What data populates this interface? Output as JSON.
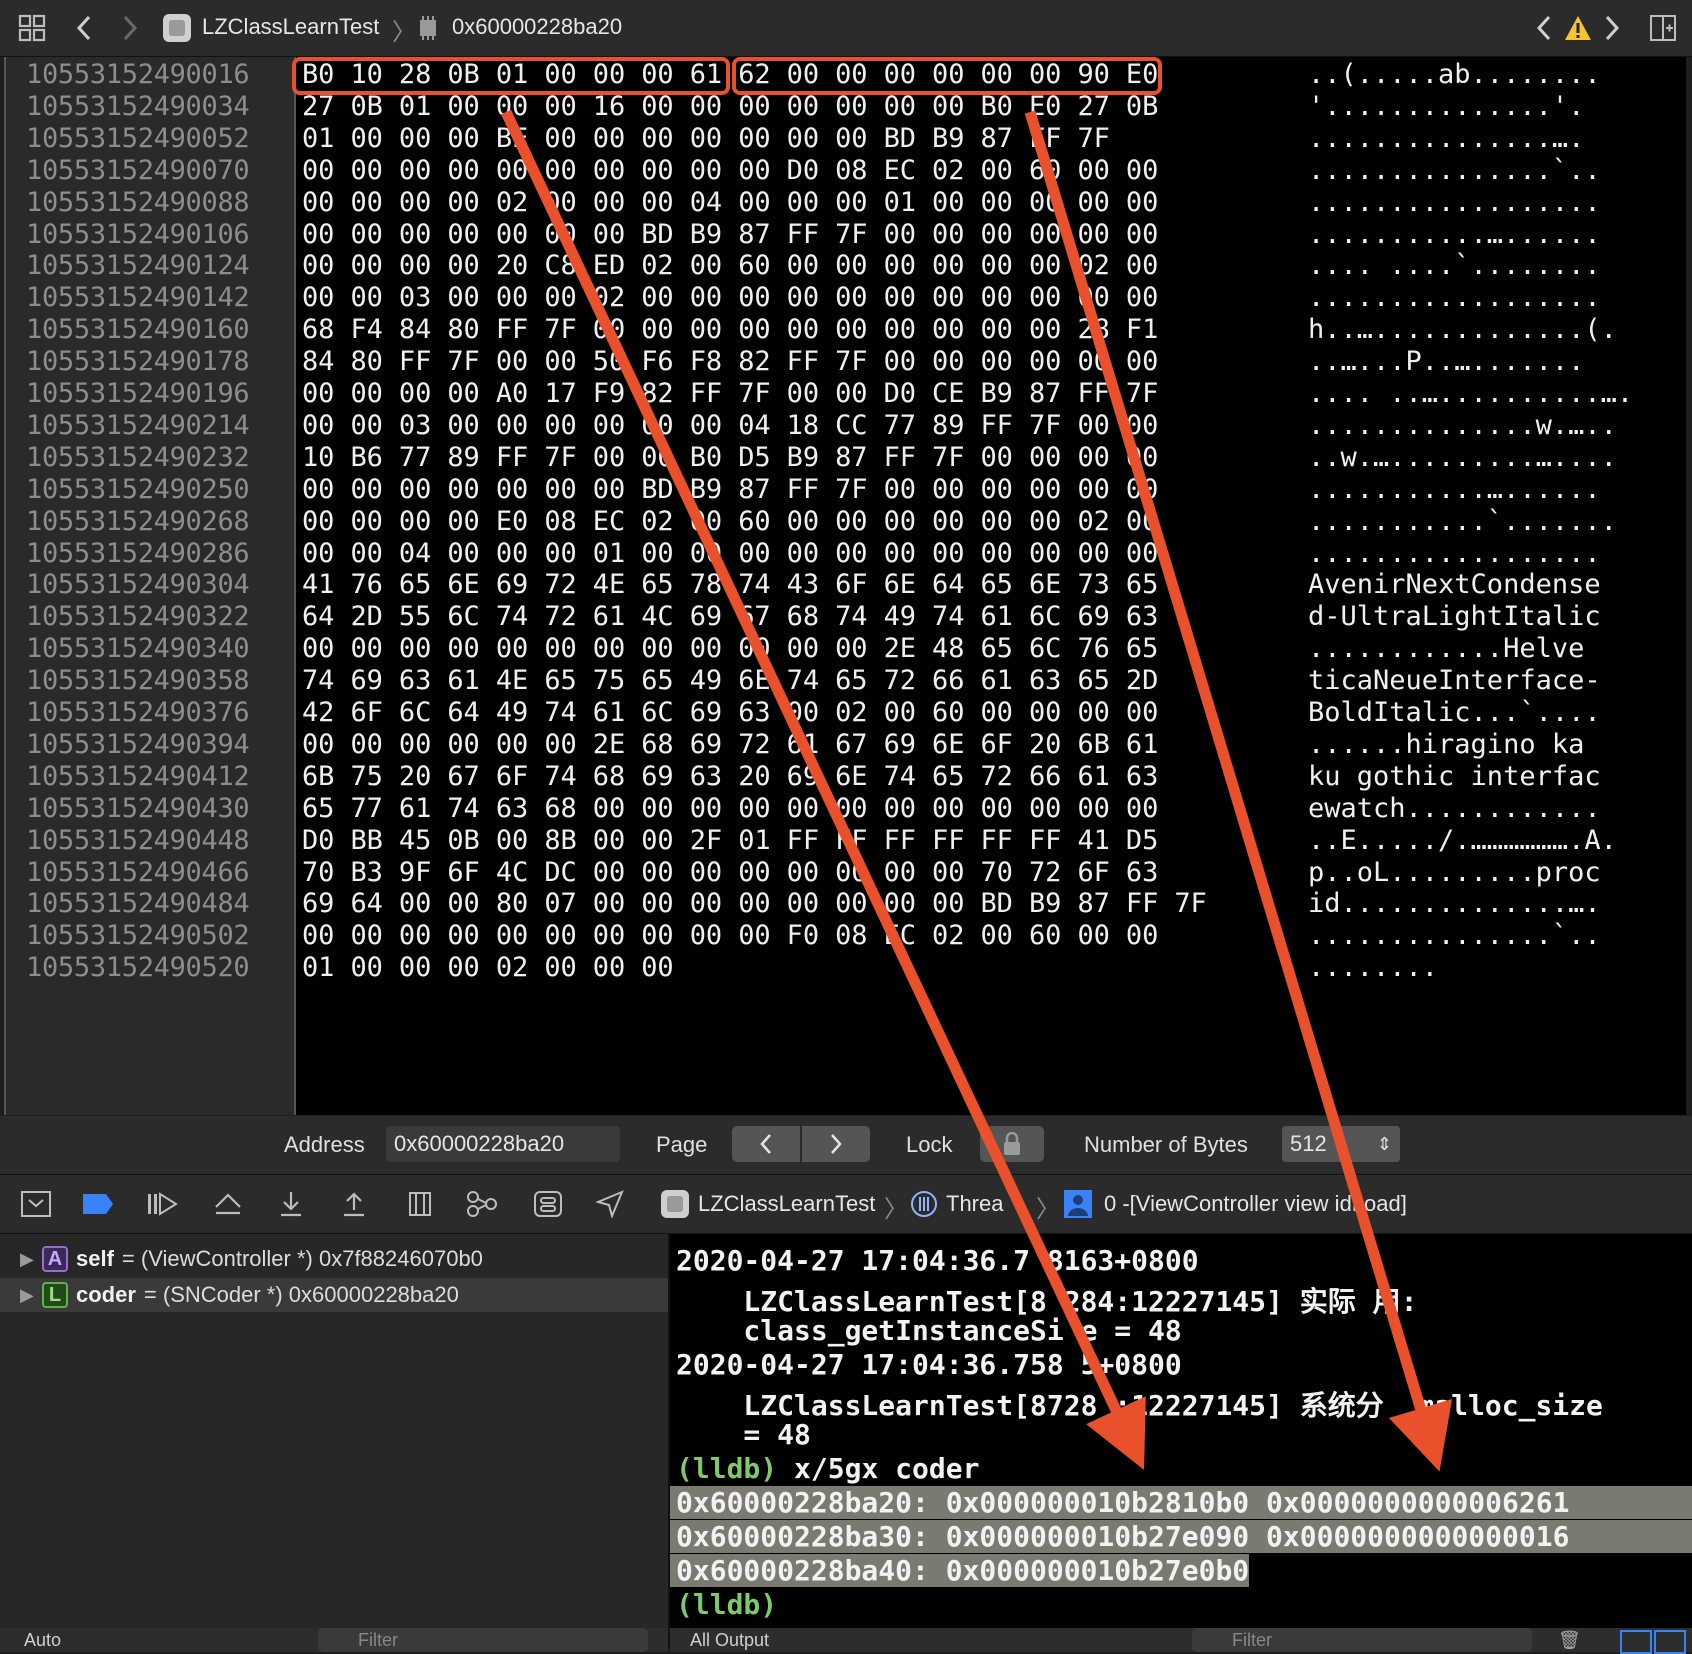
{
  "toolbar": {
    "breadcrumb_project": "LZClassLearnTest",
    "breadcrumb_memory": "0x60000228ba20"
  },
  "memory": {
    "addresses": [
      "10553152490016",
      "10553152490034",
      "10553152490052",
      "10553152490070",
      "10553152490088",
      "10553152490106",
      "10553152490124",
      "10553152490142",
      "10553152490160",
      "10553152490178",
      "10553152490196",
      "10553152490214",
      "10553152490232",
      "10553152490250",
      "10553152490268",
      "10553152490286",
      "10553152490304",
      "10553152490322",
      "10553152490340",
      "10553152490358",
      "10553152490376",
      "10553152490394",
      "10553152490412",
      "10553152490430",
      "10553152490448",
      "10553152490466",
      "10553152490484",
      "10553152490502",
      "10553152490520"
    ],
    "hex": [
      "B0 10 28 0B 01 00 00 00 61 62 00 00 00 00 00 00 90 E0",
      "27 0B 01 00 00 00 16 00 00 00 00 00 00 00 B0 E0 27 0B",
      "01 00 00 00 BE 00 00 00 00 00 00 00 BD B9 87 FF 7F",
      "00 00 00 00 00 00 00 00 00 00 D0 08 EC 02 00 60 00 00",
      "00 00 00 00 02 00 00 00 04 00 00 00 01 00 00 00 00 00",
      "00 00 00 00 00 00 00 BD B9 87 FF 7F 00 00 00 00 00 00",
      "00 00 00 00 20 C8 ED 02 00 60 00 00 00 00 00 00 02 00",
      "00 00 03 00 00 00 02 00 00 00 00 00 00 00 00 00 00 00",
      "68 F4 84 80 FF 7F 00 00 00 00 00 00 00 00 00 00 28 F1",
      "84 80 FF 7F 00 00 50 F6 F8 82 FF 7F 00 00 00 00 00 00",
      "00 00 00 00 A0 17 F9 82 FF 7F 00 00 D0 CE B9 87 FF 7F",
      "00 00 03 00 00 00 00 00 00 04 18 CC 77 89 FF 7F 00 00",
      "10 B6 77 89 FF 7F 00 00 B0 D5 B9 87 FF 7F 00 00 00 00",
      "00 00 00 00 00 00 00 BD B9 87 FF 7F 00 00 00 00 00 00",
      "00 00 00 00 E0 08 EC 02 00 60 00 00 00 00 00 00 02 00",
      "00 00 04 00 00 00 01 00 00 00 00 00 00 00 00 00 00 00",
      "41 76 65 6E 69 72 4E 65 78 74 43 6F 6E 64 65 6E 73 65",
      "64 2D 55 6C 74 72 61 4C 69 67 68 74 49 74 61 6C 69 63",
      "00 00 00 00 00 00 00 00 00 00 00 00 2E 48 65 6C 76 65",
      "74 69 63 61 4E 65 75 65 49 6E 74 65 72 66 61 63 65 2D",
      "42 6F 6C 64 49 74 61 6C 69 63 00 02 00 60 00 00 00 00",
      "00 00 00 00 00 00 2E 68 69 72 61 67 69 6E 6F 20 6B 61",
      "6B 75 20 67 6F 74 68 69 63 20 69 6E 74 65 72 66 61 63",
      "65 77 61 74 63 68 00 00 00 00 00 00 00 00 00 00 00 00",
      "D0 BB 45 0B 00 8B 00 00 2F 01 FF FF FF FF FF FF 41 D5",
      "70 B3 9F 6F 4C DC 00 00 00 00 00 00 00 00 70 72 6F 63",
      "69 64 00 00 80 07 00 00 00 00 00 00 00 00 BD B9 87 FF 7F",
      "00 00 00 00 00 00 00 00 00 00 F0 08 EC 02 00 60 00 00",
      "01 00 00 00 02 00 00 00"
    ],
    "ascii": [
      "..(.....ab........",
      "'..............'.",
      "...............….",
      "...............`..",
      "..................",
      "...........…......",
      ".... ....`........",
      "..................",
      "h..….............(.",
      "..…...P..….......",
      ".... ..…..........….",
      "..............w.…..",
      "..w.….........…....",
      "...........…......",
      "...........`.......",
      "..................",
      "AvenirNextCondense",
      "d-UltraLightItalic",
      "............Helve",
      "ticaNeueInterface-",
      "BoldItalic...`....",
      "......hiragino ka",
      "ku gothic interfac",
      "ewatch............",
      "..E...../.……………….A.",
      "p..oL.........proc",
      "id..............….",
      "...............`..",
      "........"
    ]
  },
  "address_bar": {
    "address_label": "Address",
    "address_value": "0x60000228ba20",
    "page_label": "Page",
    "lock_label": "Lock",
    "bytes_label": "Number of Bytes",
    "bytes_value": "512"
  },
  "debug_bar": {
    "project": "LZClassLearnTest",
    "thread": "Threa",
    "frame": "0 -[ViewController view idLoad]"
  },
  "variables": [
    {
      "badge": "A",
      "name": "self",
      "value": "= (ViewController *) 0x7f88246070b0",
      "color": "#9b6bd6"
    },
    {
      "badge": "L",
      "name": "coder",
      "value": "= (SNCoder *) 0x60000228ba20",
      "color": "#61b24a"
    }
  ],
  "console": {
    "lines": [
      "2020-04-27 17:04:36.7 8163+0800",
      "    LZClassLearnTest[8 284:12227145] 实际 用:",
      "    class_getInstanceSi e = 48",
      "2020-04-27 17:04:36.758 5+0800",
      "    LZClassLearnTest[8728 :12227145] 系统分  malloc_size",
      "    = 48"
    ],
    "prompt": "(lldb)",
    "command": " x/5gx coder",
    "memory_lines": [
      "0x60000228ba20: 0x000000010b2810b0 0x0000000000006261",
      "0x60000228ba30: 0x000000010b27e090 0x0000000000000016",
      "0x60000228ba40: 0x000000010b27e0b0"
    ],
    "final_prompt": "(lldb)"
  },
  "bottom": {
    "auto_label": "Auto",
    "filter_placeholder": "Filter",
    "all_output_label": "All Output"
  },
  "colors": {
    "annotation": "#e8512b",
    "prompt": "#7ec96a",
    "highlight": "#7a7a70"
  }
}
